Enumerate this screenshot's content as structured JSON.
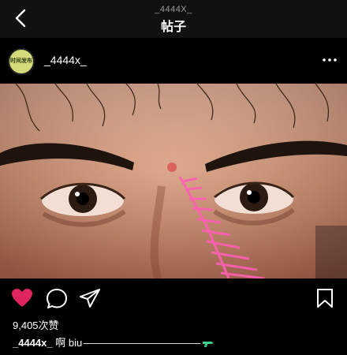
{
  "header": {
    "subtitle": "_4444X_",
    "title": "帖子"
  },
  "post": {
    "avatar_text": "时间发布",
    "username": "_4444x_",
    "likes": "9,405次赞",
    "caption_user": "_4444x_",
    "caption_text": "啊 biu",
    "liked": true
  },
  "colors": {
    "background": "#000000",
    "like": "#e0245e"
  }
}
